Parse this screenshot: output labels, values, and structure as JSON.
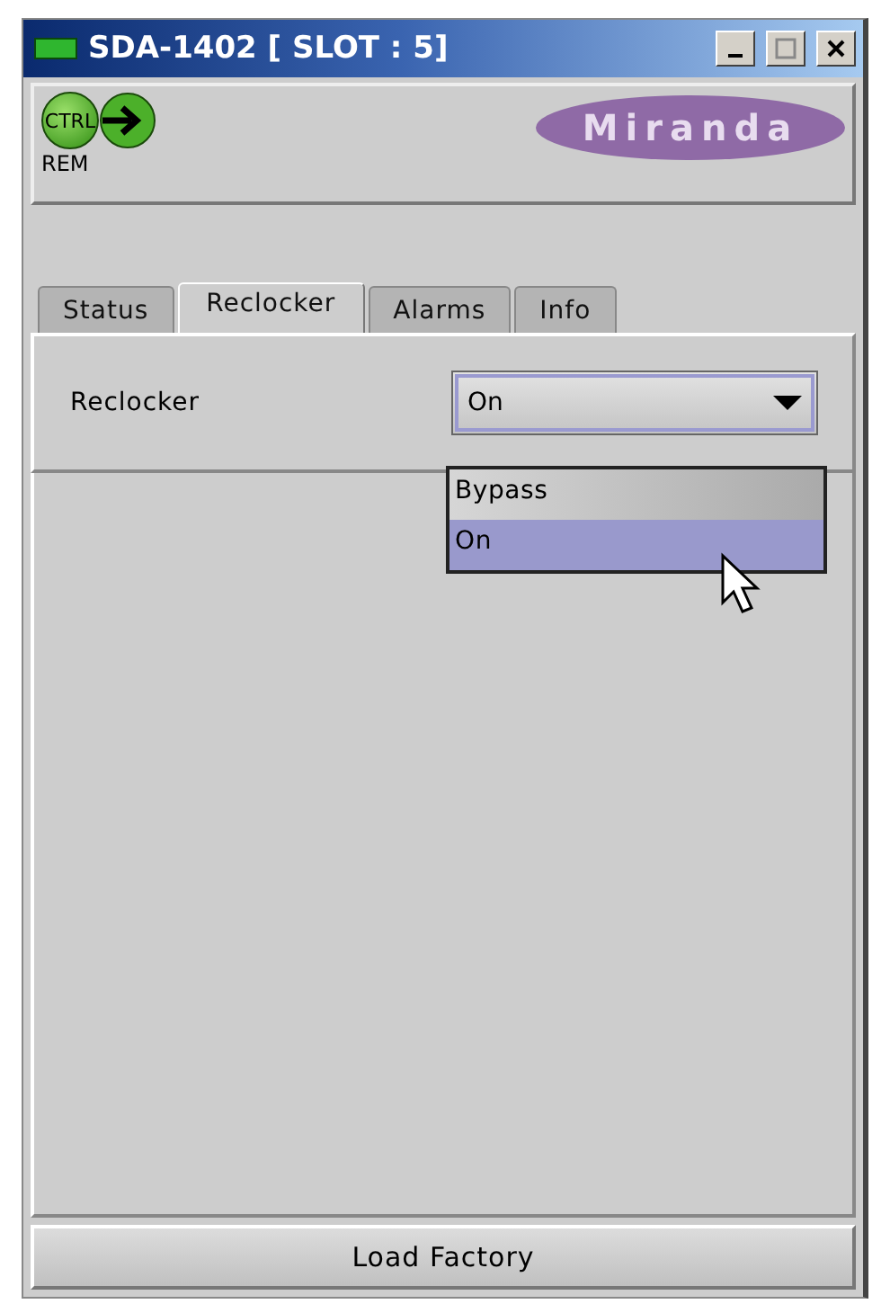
{
  "window": {
    "title": "SDA-1402 [ SLOT : 5]"
  },
  "header": {
    "control_icon_label": "CTRL",
    "control_caption": "REM",
    "logo": "Miranda"
  },
  "tabs": [
    {
      "label": "Status",
      "selected": false
    },
    {
      "label": "Reclocker",
      "selected": true
    },
    {
      "label": "Alarms",
      "selected": false
    },
    {
      "label": "Info",
      "selected": false
    }
  ],
  "reclocker": {
    "label": "Reclocker",
    "value": "On",
    "expanded": true,
    "options": [
      {
        "label": "Bypass",
        "selected": false
      },
      {
        "label": "On",
        "selected": true
      }
    ]
  },
  "buttons": [
    "Load Factory"
  ]
}
